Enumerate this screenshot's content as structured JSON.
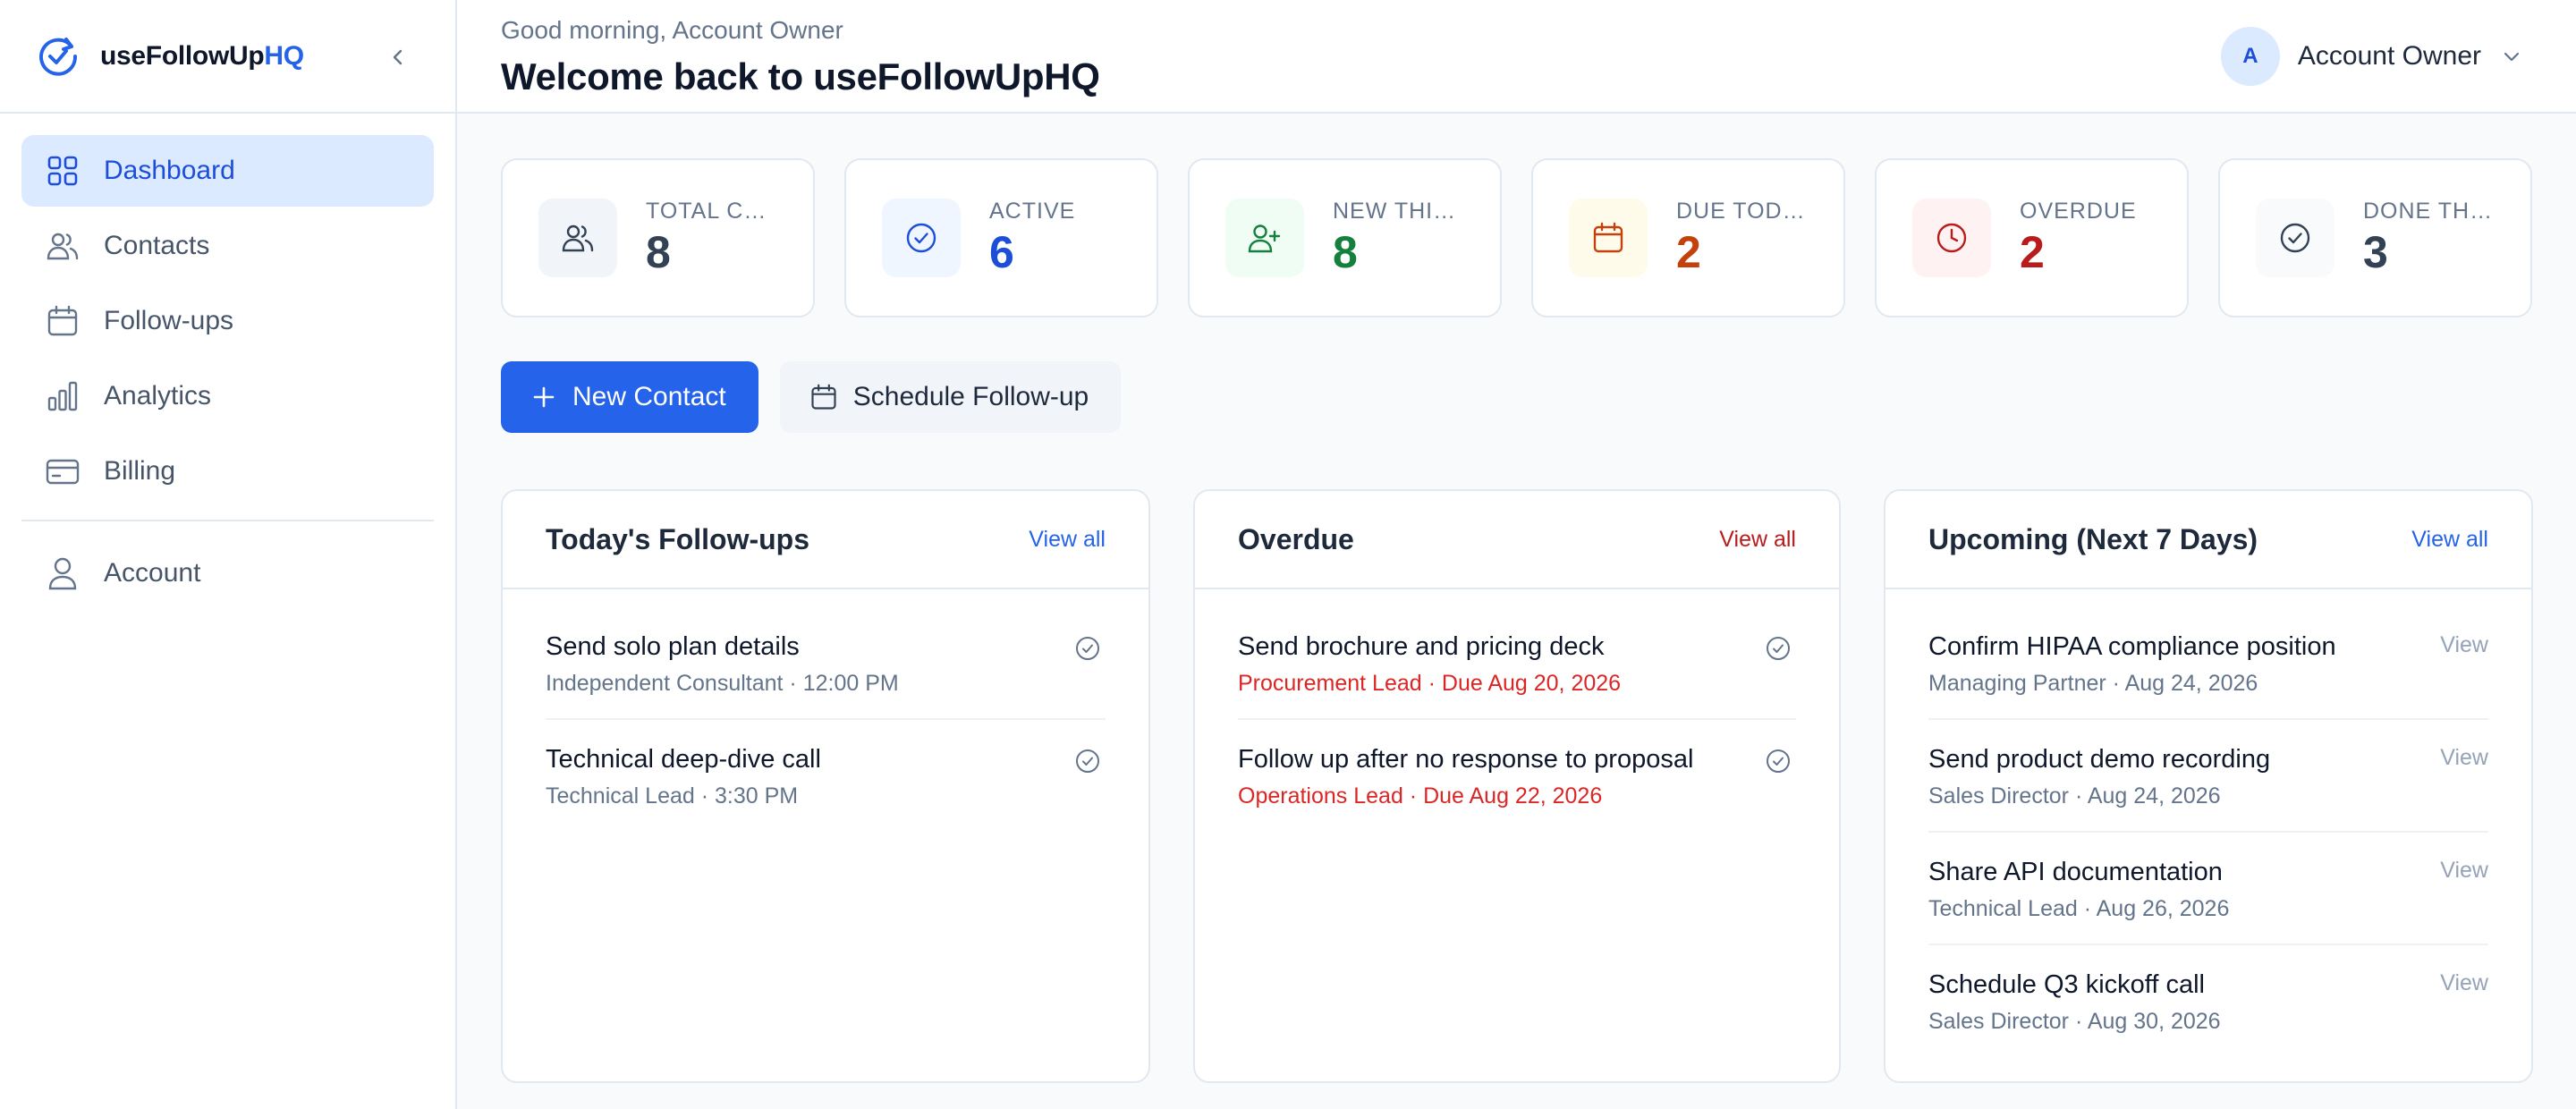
{
  "brand": {
    "name_main": "useFollowUp",
    "name_accent": "HQ"
  },
  "sidebar": {
    "items": [
      {
        "label": "Dashboard",
        "icon": "grid-icon",
        "active": true
      },
      {
        "label": "Contacts",
        "icon": "users-icon"
      },
      {
        "label": "Follow-ups",
        "icon": "calendar-icon"
      },
      {
        "label": "Analytics",
        "icon": "bar-chart-icon"
      },
      {
        "label": "Billing",
        "icon": "credit-card-icon"
      }
    ],
    "account": {
      "label": "Account",
      "icon": "user-icon"
    }
  },
  "header": {
    "greeting": "Good morning, Account Owner",
    "title": "Welcome back to useFollowUpHQ",
    "user": {
      "initial": "A",
      "name": "Account Owner"
    }
  },
  "stats": [
    {
      "label": "TOTAL CO...",
      "value": "8",
      "icon": "users-icon",
      "color": "#334155",
      "bg": "#f1f5f9"
    },
    {
      "label": "ACTIVE",
      "value": "6",
      "icon": "check-circle-icon",
      "color": "#1d4ed8",
      "bg": "#eff6ff"
    },
    {
      "label": "NEW THIS...",
      "value": "8",
      "icon": "user-plus-icon",
      "color": "#15803d",
      "bg": "#f0fdf4"
    },
    {
      "label": "DUE TODAY",
      "value": "2",
      "icon": "calendar-icon",
      "color": "#c2410c",
      "bg": "#fffbeb"
    },
    {
      "label": "OVERDUE",
      "value": "2",
      "icon": "clock-icon",
      "color": "#b91c1c",
      "bg": "#fef2f2"
    },
    {
      "label": "DONE THI...",
      "value": "3",
      "icon": "check-circle-icon",
      "color": "#334155",
      "bg": "#f8fafc"
    }
  ],
  "actions": {
    "new_contact": "New Contact",
    "schedule_followup": "Schedule Follow-up"
  },
  "panels": {
    "today": {
      "title": "Today's Follow-ups",
      "view_all": "View all",
      "items": [
        {
          "title": "Send solo plan details",
          "sub": "Independent Consultant · 12:00 PM"
        },
        {
          "title": "Technical deep-dive call",
          "sub": "Technical Lead · 3:30 PM"
        }
      ]
    },
    "overdue": {
      "title": "Overdue",
      "view_all": "View all",
      "items": [
        {
          "title": "Send brochure and pricing deck",
          "sub": "Procurement Lead · Due Aug 20, 2026"
        },
        {
          "title": "Follow up after no response to proposal",
          "sub": "Operations Lead · Due Aug 22, 2026"
        }
      ]
    },
    "upcoming": {
      "title": "Upcoming (Next 7 Days)",
      "view_all": "View all",
      "items": [
        {
          "title": "Confirm HIPAA compliance position",
          "sub": "Managing Partner · Aug 24, 2026",
          "action": "View"
        },
        {
          "title": "Send product demo recording",
          "sub": "Sales Director · Aug 24, 2026",
          "action": "View"
        },
        {
          "title": "Share API documentation",
          "sub": "Technical Lead · Aug 26, 2026",
          "action": "View"
        },
        {
          "title": "Schedule Q3 kickoff call",
          "sub": "Sales Director · Aug 30, 2026",
          "action": "View"
        }
      ]
    }
  }
}
